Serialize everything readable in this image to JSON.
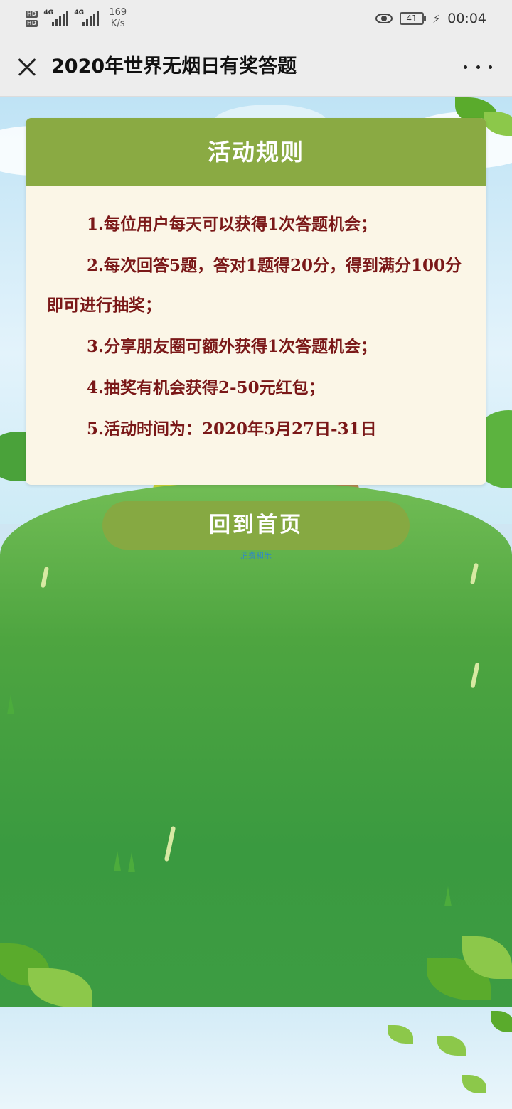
{
  "status_bar": {
    "hd_top": "HD",
    "hd_bottom": "HD",
    "net1": "4G",
    "net2": "4G",
    "speed_value": "169",
    "speed_unit": "K/s",
    "battery": "41",
    "time": "00:04"
  },
  "titlebar": {
    "title": "2020年世界无烟日有奖答题"
  },
  "card": {
    "header": "活动规则",
    "rules": [
      "1.每位用户每天可以获得1次答题机会；",
      "2.每次回答5题，答对1题得20分，得到满分100分即可进行抽奖；",
      "3.分享朋友圈可额外获得1次答题机会；",
      "4.抽奖有机会获得2-50元红包；",
      "5.活动时间为：2020年5月27日-31日"
    ]
  },
  "back_button": {
    "label": "回到首页"
  },
  "footnote": {
    "text": "消费和乐"
  },
  "colors": {
    "header_green": "#8aaa43",
    "rule_text": "#7a1818",
    "card_bg": "#fbf6e7",
    "grass": "#4ea540"
  },
  "icons": [
    "close-icon",
    "more-icon",
    "eye-icon",
    "battery-icon",
    "signal-icon"
  ]
}
